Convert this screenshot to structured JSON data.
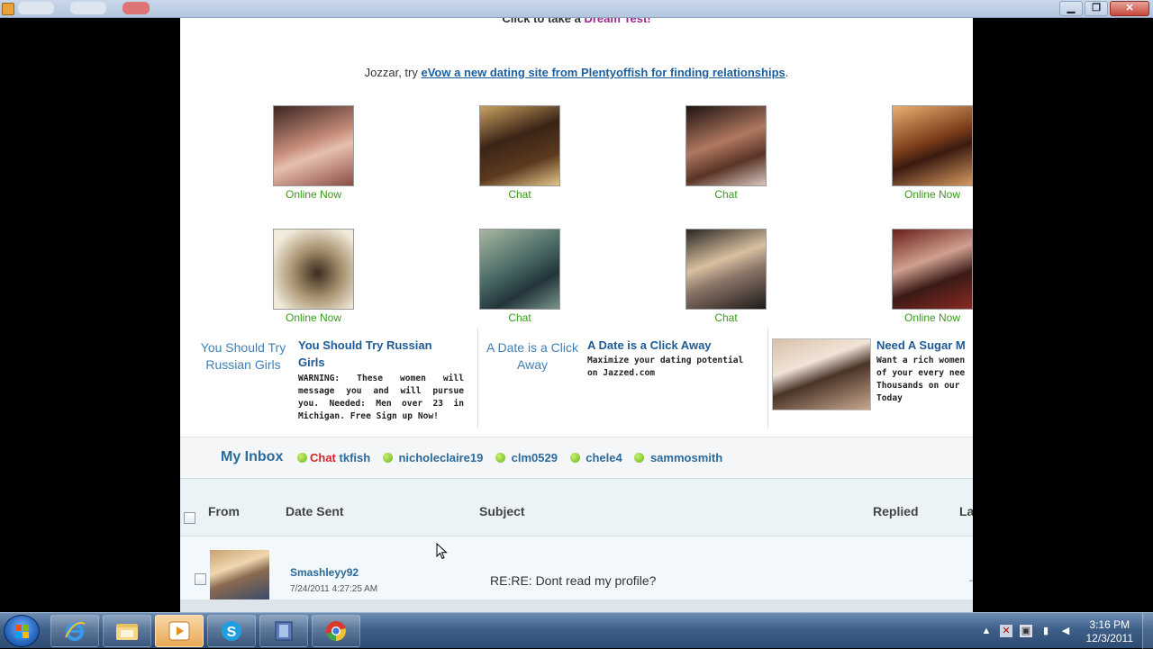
{
  "window": {
    "controls": {
      "minimize": "▁",
      "restore": "❐",
      "close": "✕"
    }
  },
  "page": {
    "top_text": "Click to take a",
    "top_link": "Dream Test!",
    "evow_prefix": "Jozzar, try",
    "evow_link": "eVow a new dating site from Plentyoffish for finding relationships",
    "evow_suffix": ".",
    "photos_row1": [
      {
        "label": "Online Now",
        "color": "#b86a63"
      },
      {
        "label": "Chat",
        "color": "#c98a3a"
      },
      {
        "label": "Chat",
        "color": "#6b4a3c"
      },
      {
        "label": "Online Now",
        "color": "#b86a30"
      }
    ],
    "photos_row2": [
      {
        "label": "Online Now",
        "color": "#a7967a"
      },
      {
        "label": "Chat",
        "color": "#6e8e86"
      },
      {
        "label": "Chat",
        "color": "#7d7a78"
      },
      {
        "label": "Online Now",
        "color": "#7b3a32"
      }
    ]
  },
  "ads": {
    "russian": {
      "left_title": "You Should Try Russian Girls",
      "title": "You Should Try Russian Girls",
      "body": "WARNING: These women will message you and will pursue you. Needed: Men over 23 in Michigan. Free Sign up Now!"
    },
    "jazzed": {
      "left_title": "A Date is a Click Away",
      "title": "A Date is a Click Away",
      "body": "Maximize your dating potential on Jazzed.com"
    },
    "sugar": {
      "title": "Need A Sugar M",
      "body": "Want a rich women of your every nee Thousands on our Today"
    }
  },
  "inbox": {
    "title": "My Inbox",
    "chat_label": "Chat",
    "users": [
      "tkfish",
      "nicholeclaire19",
      "clm0529",
      "chele4",
      "sammosmith"
    ],
    "columns": {
      "from": "From",
      "date_sent": "Date Sent",
      "subject": "Subject",
      "replied": "Replied",
      "last": "La"
    },
    "messages": [
      {
        "from": "Smashleyy92",
        "date": "7/24/2011 4:27:25 AM",
        "subject": "RE:RE: Dont read my profile?",
        "tail": "–"
      }
    ]
  },
  "taskbar": {
    "time": "3:16 PM",
    "date": "12/3/2011"
  }
}
